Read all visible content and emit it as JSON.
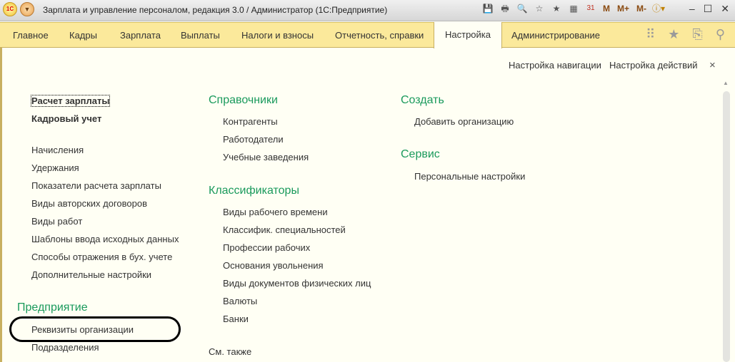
{
  "title": "Зарплата и управление персоналом, редакция 3.0 / Администратор  (1С:Предприятие)",
  "logo": "1С",
  "menu": [
    "Главное",
    "Кадры",
    "Зарплата",
    "Выплаты",
    "Налоги и взносы",
    "Отчетность, справки",
    "Настройка",
    "Администрирование"
  ],
  "toolbar": {
    "m": "M",
    "mplus": "M+",
    "mminus": "M-",
    "cal": "31"
  },
  "actions": {
    "nav": "Настройка навигации",
    "act": "Настройка действий",
    "close": "×"
  },
  "col1": {
    "bold": [
      "Расчет зарплаты",
      "Кадровый учет"
    ],
    "items": [
      "Начисления",
      "Удержания",
      "Показатели расчета зарплаты",
      "Виды авторских договоров",
      "Виды работ",
      "Шаблоны ввода исходных данных",
      "Способы отражения в бух. учете",
      "Дополнительные настройки"
    ],
    "section": "Предприятие",
    "section_items": [
      "Реквизиты организации",
      "Подразделения"
    ]
  },
  "col2": {
    "h1": "Справочники",
    "items1": [
      "Контрагенты",
      "Работодатели",
      "Учебные заведения"
    ],
    "h2": "Классификаторы",
    "items2": [
      "Виды рабочего времени",
      "Классифик. специальностей",
      "Профессии рабочих",
      "Основания увольнения",
      "Виды документов физических лиц",
      "Валюты",
      "Банки"
    ],
    "see_also": "См. также"
  },
  "col3": {
    "h1": "Создать",
    "items1": [
      "Добавить организацию"
    ],
    "h2": "Сервис",
    "items2": [
      "Персональные настройки"
    ]
  }
}
